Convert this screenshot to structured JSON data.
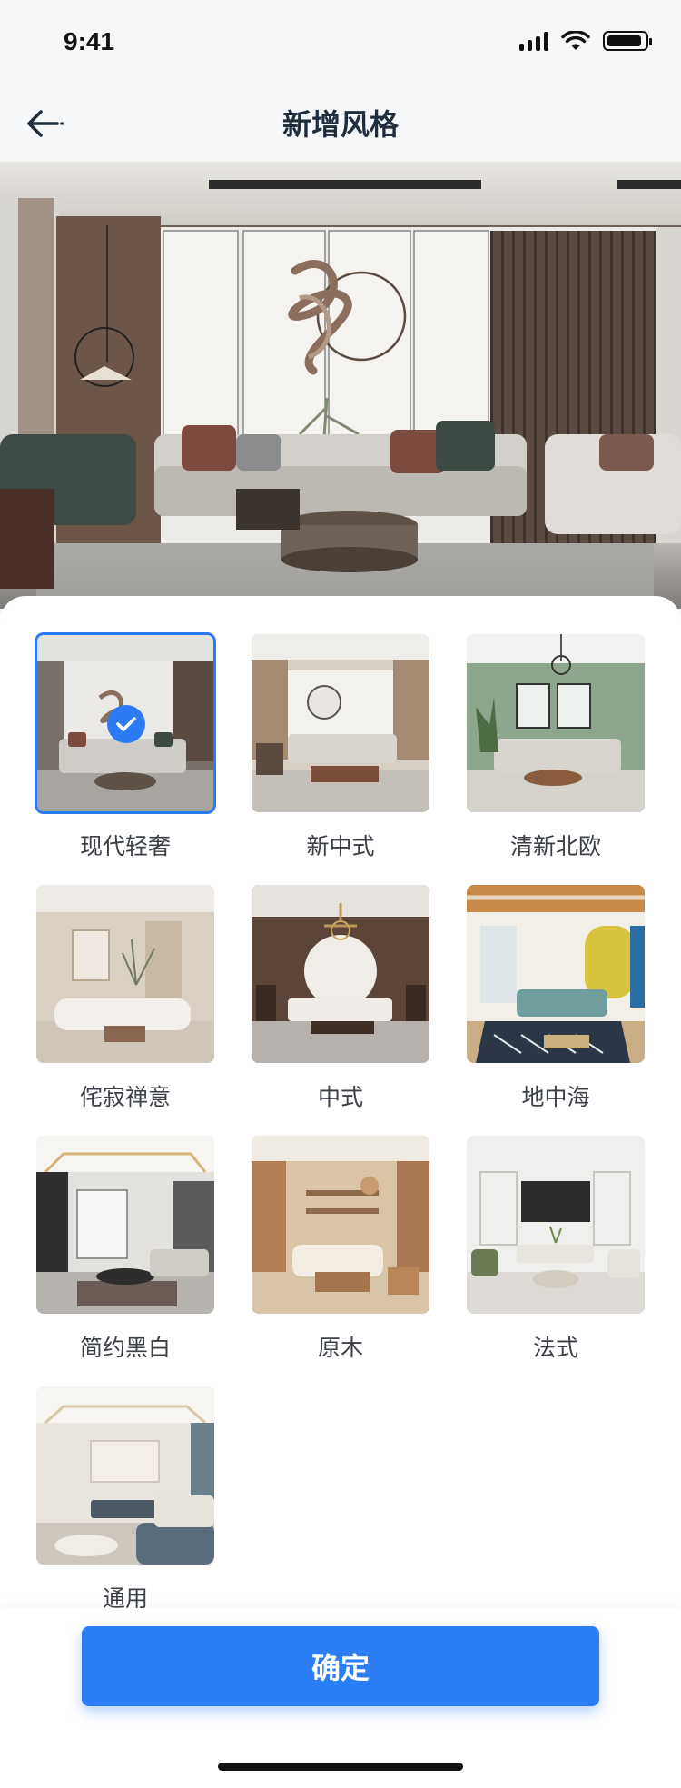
{
  "status_bar": {
    "time": "9:41"
  },
  "nav": {
    "title": "新增风格",
    "back_icon": "arrow-left-icon"
  },
  "hero": {
    "slides": 4,
    "active_index": 0
  },
  "styles": [
    {
      "label": "现代轻奢",
      "selected": true
    },
    {
      "label": "新中式",
      "selected": false
    },
    {
      "label": "清新北欧",
      "selected": false
    },
    {
      "label": "侘寂禅意",
      "selected": false
    },
    {
      "label": "中式",
      "selected": false
    },
    {
      "label": "地中海",
      "selected": false
    },
    {
      "label": "简约黑白",
      "selected": false
    },
    {
      "label": "原木",
      "selected": false
    },
    {
      "label": "法式",
      "selected": false
    },
    {
      "label": "通用",
      "selected": false
    }
  ],
  "confirm_button": {
    "label": "确定"
  },
  "colors": {
    "accent": "#2b7ef6",
    "title": "#1f2d3d"
  }
}
